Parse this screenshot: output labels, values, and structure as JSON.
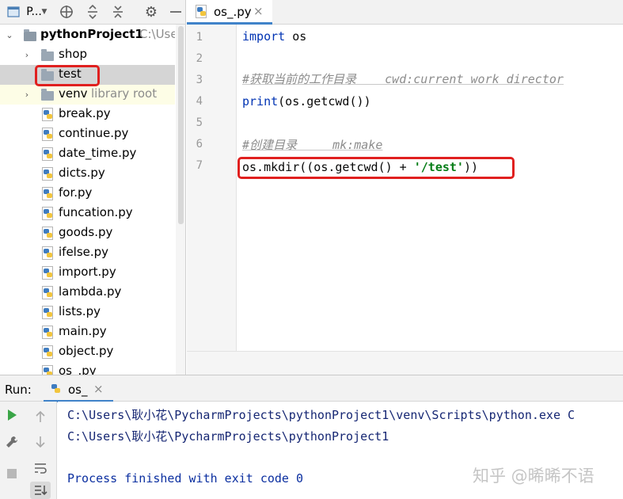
{
  "project_toolbar": {
    "view_label": "P...",
    "view_dropdown_icon": "chevron-down-icon",
    "icons": [
      "crosshair-icon",
      "expand-all-icon",
      "collapse-all-icon",
      "gear-icon",
      "minimize-icon"
    ]
  },
  "tree": {
    "root": {
      "name": "pythonProject1",
      "path_hint": "C:\\Users"
    },
    "items": [
      {
        "name": "shop",
        "type": "folder"
      },
      {
        "name": "test",
        "type": "folder"
      },
      {
        "name": "venv",
        "type": "folder",
        "hint": "library root"
      },
      {
        "name": "break.py",
        "type": "py"
      },
      {
        "name": "continue.py",
        "type": "py"
      },
      {
        "name": "date_time.py",
        "type": "py"
      },
      {
        "name": "dicts.py",
        "type": "py"
      },
      {
        "name": "for.py",
        "type": "py"
      },
      {
        "name": "funcation.py",
        "type": "py"
      },
      {
        "name": "goods.py",
        "type": "py"
      },
      {
        "name": "ifelse.py",
        "type": "py"
      },
      {
        "name": "import.py",
        "type": "py"
      },
      {
        "name": "lambda.py",
        "type": "py"
      },
      {
        "name": "lists.py",
        "type": "py"
      },
      {
        "name": "main.py",
        "type": "py"
      },
      {
        "name": "object.py",
        "type": "py"
      },
      {
        "name": "os_.py",
        "type": "py"
      }
    ]
  },
  "editor": {
    "tab": {
      "label": "os_.py",
      "close": "×"
    },
    "line_numbers": [
      "1",
      "2",
      "3",
      "4",
      "5",
      "6",
      "7"
    ],
    "code": {
      "l1_kw": "import",
      "l1_rest": " os",
      "l3_comment": "#获取当前的工作目录    cwd:current work director",
      "l4_kw": "print",
      "l4_rest": "(os.getcwd())",
      "l6_comment": "#创建目录     mk:make",
      "l7_pre": "os.mkdir((os.getcwd() + ",
      "l7_str": "'/test'",
      "l7_post": "))"
    }
  },
  "run": {
    "label": "Run:",
    "tab_label": "os_",
    "tab_close": "×",
    "side_icons": [
      "play-icon",
      "wrench-icon",
      "stop-icon",
      "scroll-up-icon",
      "scroll-down-icon",
      "soft-wrap-icon",
      "scroll-to-end-icon"
    ],
    "console": [
      "C:\\Users\\耿小花\\PycharmProjects\\pythonProject1\\venv\\Scripts\\python.exe C",
      "C:\\Users\\耿小花\\PycharmProjects\\pythonProject1",
      "",
      "Process finished with exit code 0"
    ]
  },
  "watermark": "知乎 @晞晞不语",
  "colors": {
    "highlight": "#e0201f",
    "tab_underline": "#4083c9",
    "keyword": "#0033b3",
    "string": "#067d17",
    "comment": "#8c8c8c"
  }
}
